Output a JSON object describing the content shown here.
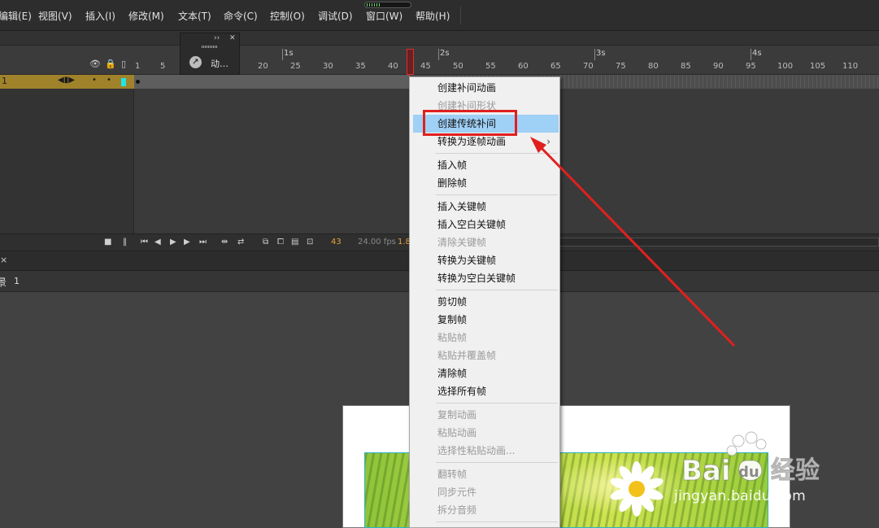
{
  "menubar": {
    "items": [
      "编辑(E)",
      "视图(V)",
      "插入(I)",
      "修改(M)",
      "文本(T)",
      "命令(C)",
      "控制(O)",
      "调试(D)",
      "窗口(W)",
      "帮助(H)"
    ]
  },
  "timeline": {
    "second_markers": [
      "1s",
      "2s",
      "3s",
      "4s"
    ],
    "frame_ticks": [
      "1",
      "5",
      "20",
      "25",
      "30",
      "35",
      "40",
      "45",
      "50",
      "55",
      "60",
      "65",
      "70",
      "75",
      "80",
      "85",
      "90",
      "95",
      "100",
      "105",
      "110"
    ],
    "layer": {
      "name": "1"
    },
    "float_panel_label": "动…",
    "controls": {
      "current_frame": "43",
      "fps": "24.00 fps",
      "elapsed": "1.8"
    }
  },
  "scene": {
    "label": "1"
  },
  "context_menu": {
    "items": [
      {
        "label": "创建补间动画",
        "state": "enabled"
      },
      {
        "label": "创建补间形状",
        "state": "disabled"
      },
      {
        "label": "创建传统补间",
        "state": "highlighted"
      },
      {
        "label": "转换为逐帧动画",
        "state": "enabled",
        "submenu": true
      },
      {
        "label": "插入帧",
        "state": "enabled"
      },
      {
        "label": "删除帧",
        "state": "enabled"
      },
      {
        "label": "插入关键帧",
        "state": "enabled"
      },
      {
        "label": "插入空白关键帧",
        "state": "enabled"
      },
      {
        "label": "清除关键帧",
        "state": "disabled"
      },
      {
        "label": "转换为关键帧",
        "state": "enabled"
      },
      {
        "label": "转换为空白关键帧",
        "state": "enabled"
      },
      {
        "label": "剪切帧",
        "state": "enabled"
      },
      {
        "label": "复制帧",
        "state": "enabled"
      },
      {
        "label": "粘贴帧",
        "state": "disabled"
      },
      {
        "label": "粘贴并覆盖帧",
        "state": "disabled"
      },
      {
        "label": "清除帧",
        "state": "enabled"
      },
      {
        "label": "选择所有帧",
        "state": "enabled"
      },
      {
        "label": "复制动画",
        "state": "disabled"
      },
      {
        "label": "粘贴动画",
        "state": "disabled"
      },
      {
        "label": "选择性粘贴动画...",
        "state": "disabled"
      },
      {
        "label": "翻转帧",
        "state": "disabled"
      },
      {
        "label": "同步元件",
        "state": "disabled"
      },
      {
        "label": "拆分音频",
        "state": "disabled"
      }
    ],
    "submenu_arrow": "›"
  },
  "watermark": {
    "url_text": "jingyan.baidu.com"
  },
  "colors": {
    "layer_row": "#a0822a",
    "playhead": "#d43030",
    "menu_highlight": "#9fd0f6",
    "annotation_red": "#e0201e",
    "selected_frame_num": "#e6a23c"
  }
}
